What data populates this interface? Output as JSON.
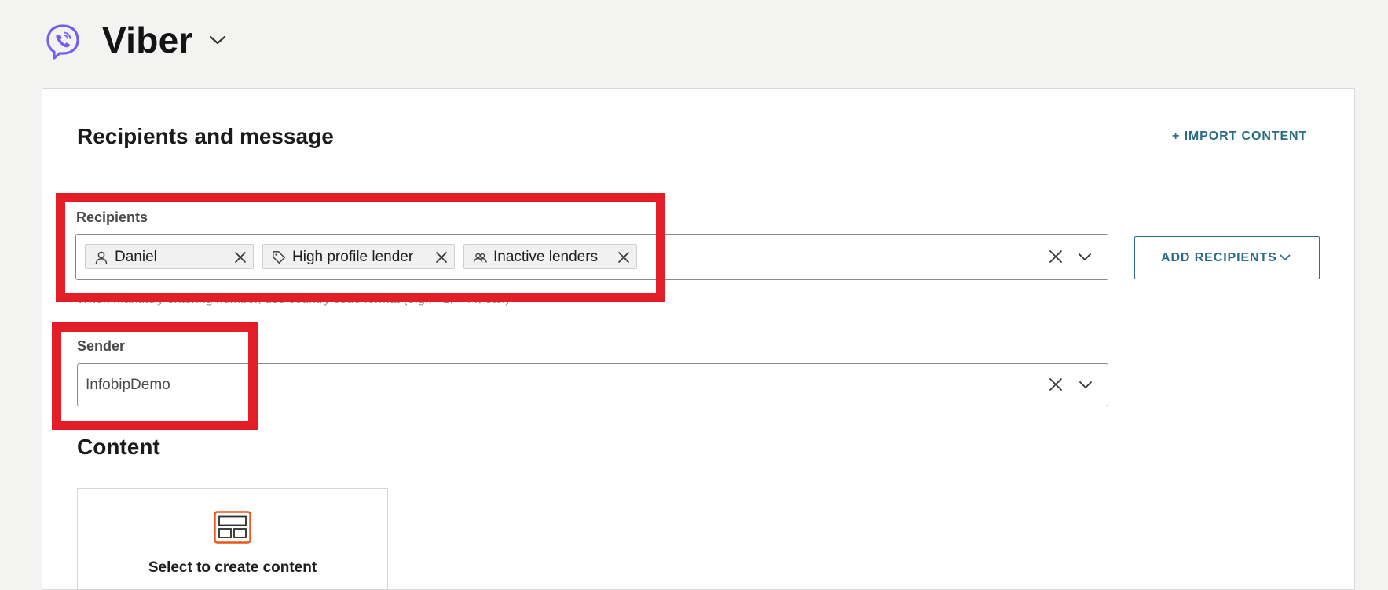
{
  "header": {
    "title": "Viber",
    "logo_icon": "viber-logo-icon",
    "chevron_icon": "chevron-down-icon",
    "brand_color": "#7360f2"
  },
  "section": {
    "title": "Recipients and message",
    "import_label": "+ IMPORT CONTENT"
  },
  "recipients": {
    "label": "Recipients",
    "chips": [
      {
        "label": "Daniel",
        "icon": "person-icon"
      },
      {
        "label": "High profile lender",
        "icon": "tag-icon"
      },
      {
        "label": "Inactive lenders",
        "icon": "group-icon"
      }
    ],
    "hint": "When manually entering number, use country code format (e.g., +1, +44, etc.)",
    "add_button_label": "ADD RECIPIENTS"
  },
  "sender": {
    "label": "Sender",
    "value": "InfobipDemo"
  },
  "content": {
    "title": "Content",
    "create_label": "Select to create content",
    "create_icon": "layout-template-icon",
    "accent_color": "#e8571a"
  },
  "colors": {
    "link": "#2a6c86",
    "highlight": "#e41e26"
  }
}
